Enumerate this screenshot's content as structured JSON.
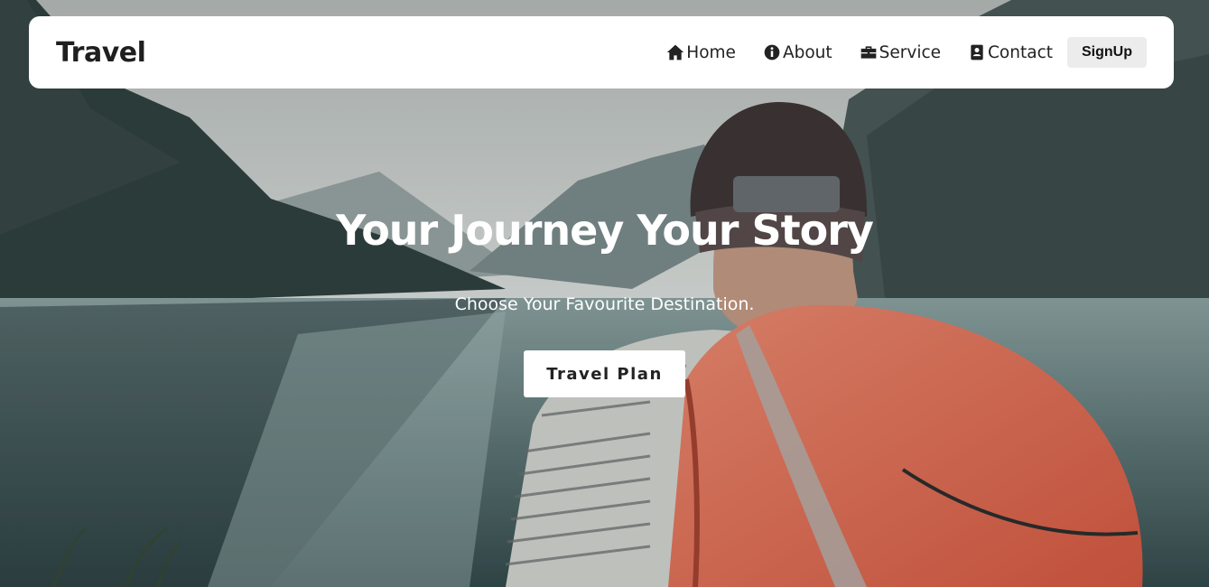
{
  "navbar": {
    "brand": "Travel",
    "items": [
      {
        "label": "Home",
        "icon": "home-icon"
      },
      {
        "label": "About",
        "icon": "info-circle-icon"
      },
      {
        "label": "Service",
        "icon": "briefcase-icon"
      },
      {
        "label": "Contact",
        "icon": "contact-card-icon"
      }
    ],
    "signup_label": "SignUp"
  },
  "hero": {
    "headline": "Your Journey Your Story",
    "subhead": "Choose Your Favourite Destination.",
    "cta_label": "Travel Plan",
    "background": "hiker-with-orange-backpack-at-mountain-lake-photo"
  },
  "colors": {
    "navbar_bg": "#ffffff",
    "text_dark": "#222222",
    "signup_bg": "#ececec",
    "backpack": "#e8735a"
  }
}
